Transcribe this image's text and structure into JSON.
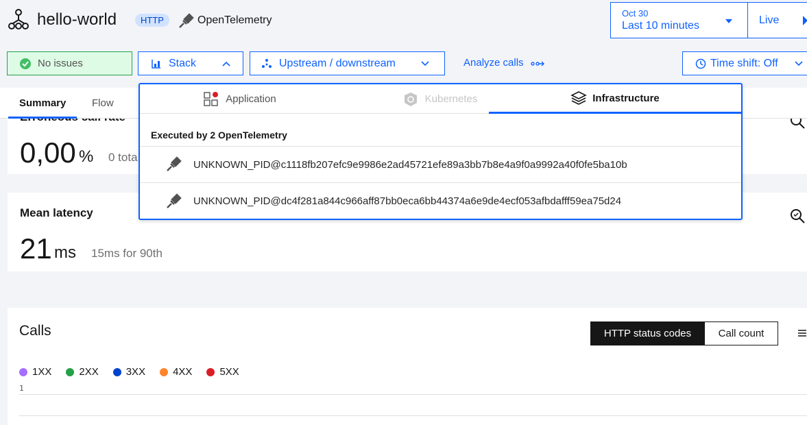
{
  "service": {
    "name": "hello-world",
    "protocol_badge": "HTTP",
    "technology": "OpenTelemetry"
  },
  "time_picker": {
    "date": "Oct 30",
    "range": "Last 10 minutes",
    "live_label": "Live"
  },
  "toolbar": {
    "status": "No issues",
    "stack_label": "Stack",
    "upstream_label": "Upstream / downstream",
    "analyze_label": "Analyze calls",
    "time_shift_label": "Time shift: Off"
  },
  "tabs": {
    "summary": "Summary",
    "flow": "Flow"
  },
  "metrics": {
    "erroneous": {
      "label": "Erroneous call rate",
      "value": "0,00",
      "unit": "%",
      "sub": "0 tota"
    },
    "latency": {
      "label": "Mean latency",
      "value": "21",
      "unit": "ms",
      "sub": "15ms for 90th"
    }
  },
  "calls": {
    "title": "Calls",
    "toggle": [
      "HTTP status codes",
      "Call count"
    ],
    "legend": [
      {
        "label": "1XX",
        "color": "#a56eff"
      },
      {
        "label": "2XX",
        "color": "#24a148"
      },
      {
        "label": "3XX",
        "color": "#0043ce"
      },
      {
        "label": "4XX",
        "color": "#ff832b"
      },
      {
        "label": "5XX",
        "color": "#da1e28"
      }
    ],
    "y_tick": "1"
  },
  "dropdown": {
    "tabs": [
      "Application",
      "Kubernetes",
      "Infrastructure"
    ],
    "active_tab": "Infrastructure",
    "section_title": "Executed by 2 OpenTelemetry",
    "items": [
      "UNKNOWN_PID@c1118fb207efc9e9986e2ad45721efe89a3bb7b8e4a9f0a9992a40f0fe5ba10b",
      "UNKNOWN_PID@dc4f281a844c966aff87bb0eca6bb44374a6e9de4ecf053afbdafff59ea75d24"
    ]
  },
  "colors": {
    "primary": "#0f62fe",
    "success": "#24a148"
  }
}
